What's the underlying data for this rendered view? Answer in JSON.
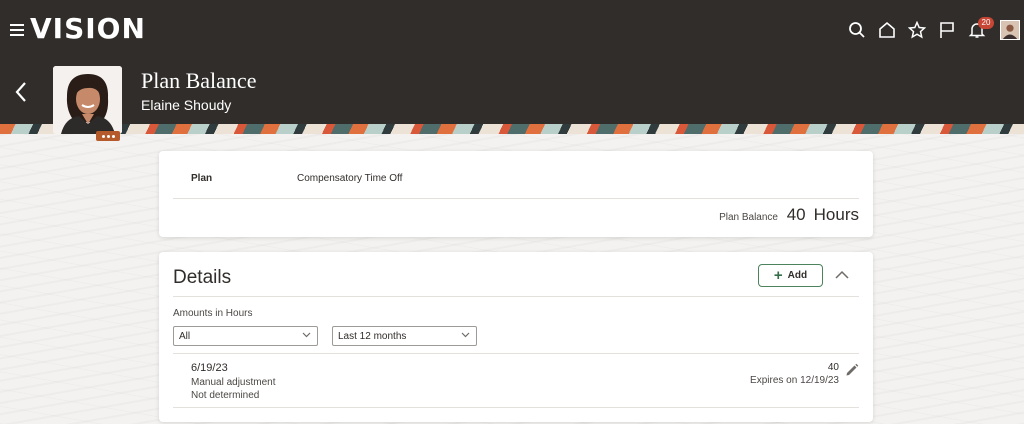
{
  "app": {
    "logo": "VISION",
    "notifications_count": "20",
    "icons": [
      "menu-icon",
      "search-icon",
      "home-icon",
      "star-icon",
      "flag-icon",
      "bell-icon",
      "user-avatar"
    ]
  },
  "header": {
    "title": "Plan Balance",
    "subtitle": "Elaine Shoudy"
  },
  "plan_card": {
    "plan_label": "Plan",
    "plan_value": "Compensatory Time Off",
    "balance_label": "Plan Balance",
    "balance_number": "40",
    "balance_unit": "Hours"
  },
  "details": {
    "title": "Details",
    "add_label": "Add",
    "amounts_label": "Amounts in Hours",
    "filter_type": "All",
    "filter_period": "Last 12 months",
    "entries": [
      {
        "date": "6/19/23",
        "type": "Manual adjustment",
        "status": "Not determined",
        "amount": "40",
        "expires": "Expires on 12/19/23"
      }
    ]
  },
  "colors": {
    "header_bg": "#312d2a",
    "accent_green": "#356e4b",
    "badge_red": "#c74634"
  }
}
